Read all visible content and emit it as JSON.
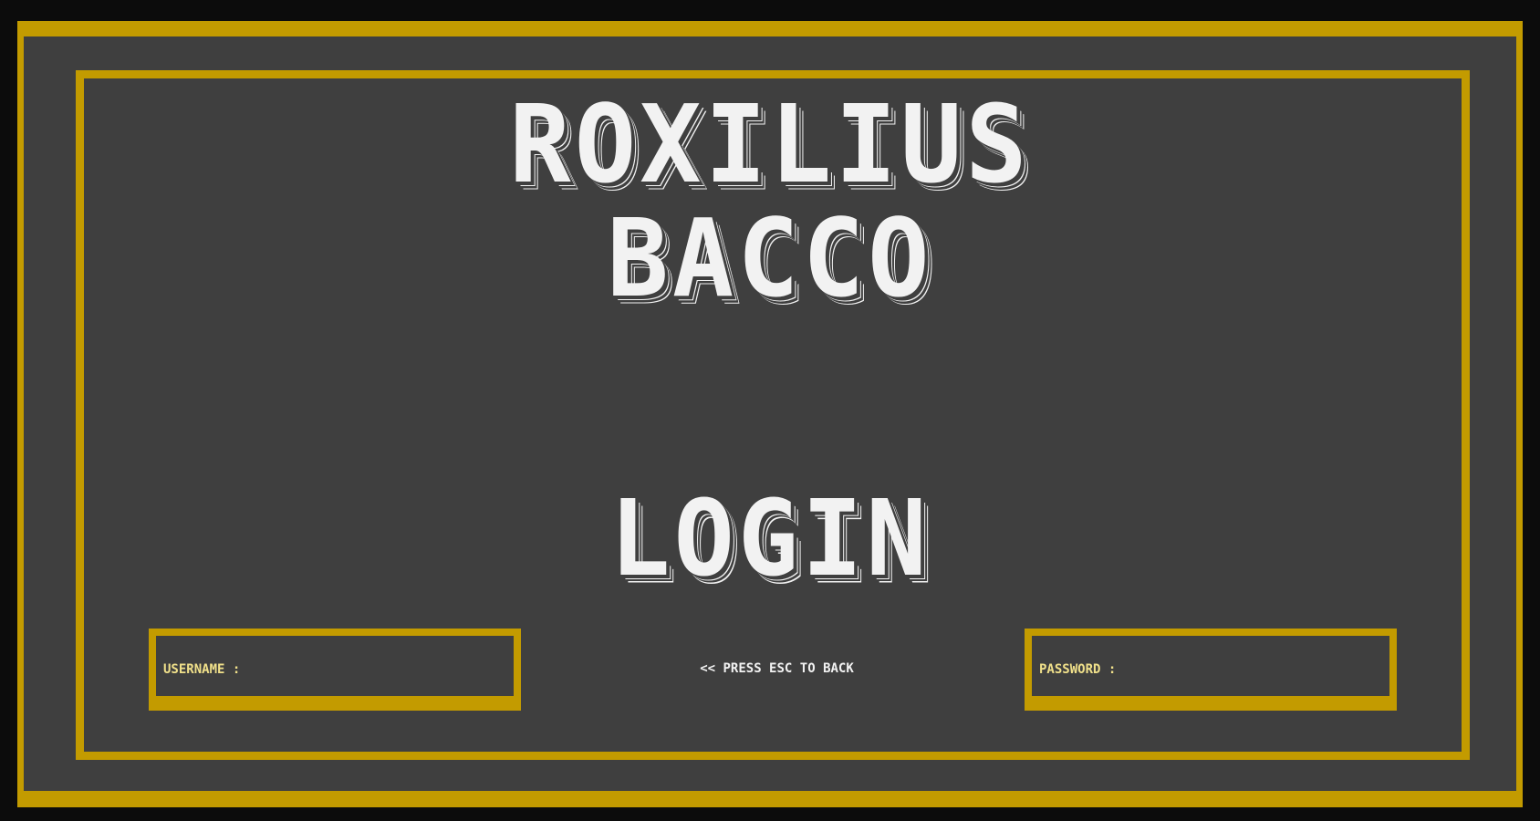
{
  "title": {
    "line1": "ROXILIUS",
    "line2": "BACCO"
  },
  "login": {
    "heading": "LOGIN",
    "username_label": "USERNAME :",
    "username_value": "",
    "password_label": "PASSWORD :",
    "password_value": "",
    "back_hint": "<< PRESS ESC TO BACK"
  },
  "colors": {
    "frame": "#c39b00",
    "background": "#3f3f3f",
    "outer_background": "#0c0c0c",
    "title_text": "#f2f2f2",
    "label_text": "#f0e08a"
  }
}
